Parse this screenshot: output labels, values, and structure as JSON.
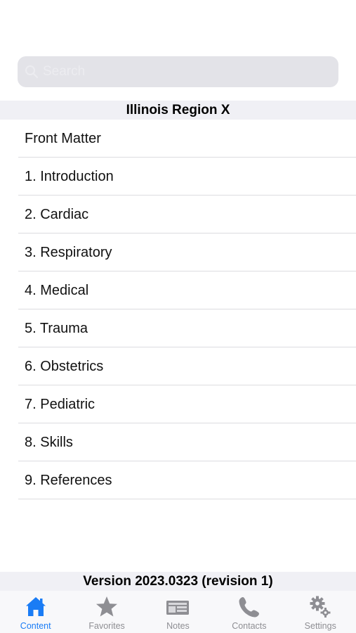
{
  "search": {
    "placeholder": "Search"
  },
  "section": {
    "title": "Illinois Region X"
  },
  "toc": {
    "items": [
      {
        "label": "Front Matter"
      },
      {
        "label": "1. Introduction"
      },
      {
        "label": "2. Cardiac"
      },
      {
        "label": "3. Respiratory"
      },
      {
        "label": "4. Medical"
      },
      {
        "label": "5. Trauma"
      },
      {
        "label": "6. Obstetrics"
      },
      {
        "label": "7. Pediatric"
      },
      {
        "label": "8. Skills"
      },
      {
        "label": "9. References"
      }
    ]
  },
  "footer": {
    "version": "Version 2023.0323 (revision 1)"
  },
  "tabbar": {
    "tabs": [
      {
        "label": "Content",
        "icon": "house-icon",
        "active": true
      },
      {
        "label": "Favorites",
        "icon": "star-icon",
        "active": false
      },
      {
        "label": "Notes",
        "icon": "notes-icon",
        "active": false
      },
      {
        "label": "Contacts",
        "icon": "phone-icon",
        "active": false
      },
      {
        "label": "Settings",
        "icon": "gears-icon",
        "active": false
      }
    ]
  },
  "colors": {
    "accent": "#1a7cf5",
    "inactive": "#8e8e93",
    "header_bg": "#f0f0f5",
    "search_bg": "#e3e3e8"
  }
}
